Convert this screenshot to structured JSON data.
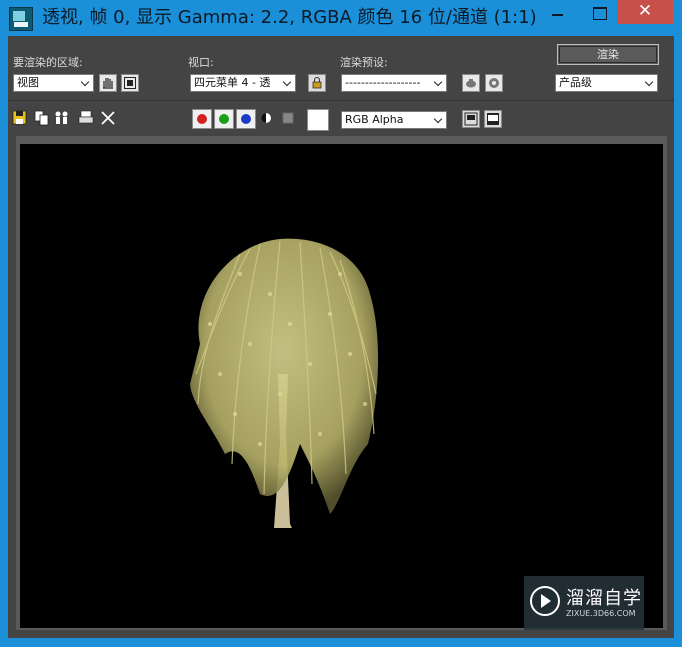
{
  "window": {
    "title": "透视, 帧 0, 显示 Gamma: 2.2, RGBA 颜色 16 位/通道 (1:1)",
    "close_glyph": "✕"
  },
  "toolbar": {
    "area_label": "要渲染的区域:",
    "area_value": "视图",
    "viewport_label": "视口:",
    "viewport_value": "四元菜单 4 - 透",
    "preset_label": "渲染预设:",
    "preset_value": "-------------------",
    "render_button": "渲染",
    "quality_value": "产品级",
    "channel_value": "RGB Alpha"
  },
  "watermark": {
    "brand": "溜溜自学",
    "url": "ZIXUE.3D66.COM"
  },
  "colors": {
    "red_channel": "#d42020",
    "green_channel": "#18a018",
    "blue_channel": "#1a3cc8"
  }
}
